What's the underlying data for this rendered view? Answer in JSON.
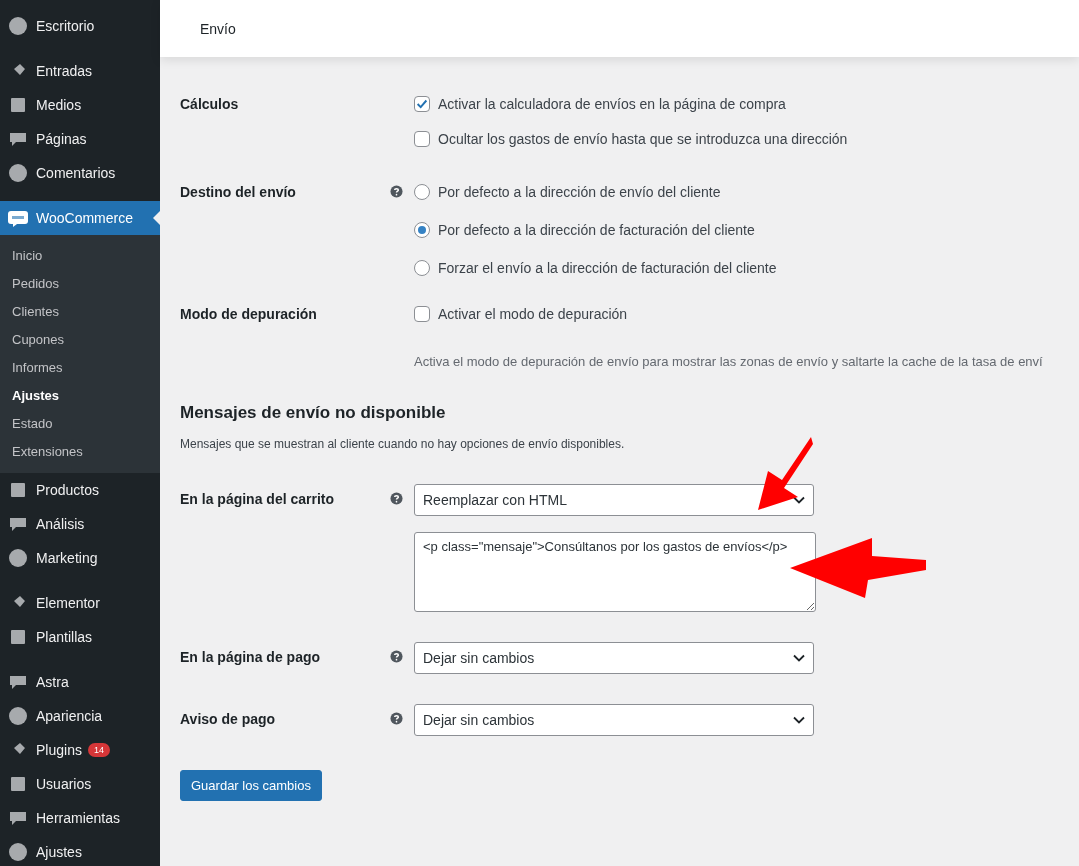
{
  "header": {
    "title": "Envío"
  },
  "sidebar": {
    "groups": [
      [
        {
          "label": "Escritorio",
          "selected": false
        }
      ],
      [
        {
          "label": "Entradas",
          "selected": false
        },
        {
          "label": "Medios",
          "selected": false
        },
        {
          "label": "Páginas",
          "selected": false
        },
        {
          "label": "Comentarios",
          "selected": false
        }
      ],
      [
        {
          "label": "WooCommerce",
          "selected": true,
          "submenu": [
            {
              "label": "Inicio",
              "selected": false
            },
            {
              "label": "Pedidos",
              "selected": false
            },
            {
              "label": "Clientes",
              "selected": false
            },
            {
              "label": "Cupones",
              "selected": false
            },
            {
              "label": "Informes",
              "selected": false
            },
            {
              "label": "Ajustes",
              "selected": true
            },
            {
              "label": "Estado",
              "selected": false
            },
            {
              "label": "Extensiones",
              "selected": false
            }
          ]
        },
        {
          "label": "Productos",
          "selected": false
        },
        {
          "label": "Análisis",
          "selected": false
        },
        {
          "label": "Marketing",
          "selected": false
        }
      ],
      [
        {
          "label": "Elementor",
          "selected": false
        },
        {
          "label": "Plantillas",
          "selected": false
        }
      ],
      [
        {
          "label": "Astra",
          "selected": false
        },
        {
          "label": "Apariencia",
          "selected": false
        },
        {
          "label": "Plugins",
          "selected": false,
          "badge": "14"
        },
        {
          "label": "Usuarios",
          "selected": false
        },
        {
          "label": "Herramientas",
          "selected": false
        },
        {
          "label": "Ajustes",
          "selected": false
        }
      ]
    ]
  },
  "sections": [
    {
      "rows": [
        {
          "label": "Cálculos",
          "help": false,
          "kind": "checks",
          "options": [
            {
              "label": "Activar la calculadora de envíos en la página de compra",
              "checked": true
            },
            {
              "label": "Ocultar los gastos de envío hasta que se introduzca una dirección",
              "checked": false
            }
          ]
        },
        {
          "label": "Destino del envío",
          "help": true,
          "kind": "radios",
          "options": [
            {
              "label": "Por defecto a la dirección de envío del cliente",
              "selected": false
            },
            {
              "label": "Por defecto a la dirección de facturación del cliente",
              "selected": true
            },
            {
              "label": "Forzar el envío a la dirección de facturación del cliente",
              "selected": false
            }
          ]
        },
        {
          "label": "Modo de depuración",
          "help": false,
          "kind": "checks",
          "options": [
            {
              "label": "Activar el modo de depuración",
              "checked": false
            }
          ],
          "description": "Activa el modo de depuración de envío para mostrar las zonas de envío y saltarte la cache de la tasa de enví"
        }
      ]
    },
    {
      "title": "Mensajes de envío no disponible",
      "description": "Mensajes que se muestran al cliente cuando no hay opciones de envío disponibles.",
      "rows": [
        {
          "label": "En la página del carrito",
          "help": true,
          "kind": "select",
          "value": "Reemplazar con HTML",
          "textarea": "<p class=\"mensaje\">Consúltanos por los gastos de envíos</p>"
        },
        {
          "label": "En la página de pago",
          "help": true,
          "kind": "select",
          "value": "Dejar sin cambios"
        },
        {
          "label": "Aviso de pago",
          "help": true,
          "kind": "select",
          "value": "Dejar sin cambios"
        }
      ]
    }
  ],
  "save_button": "Guardar los cambios"
}
